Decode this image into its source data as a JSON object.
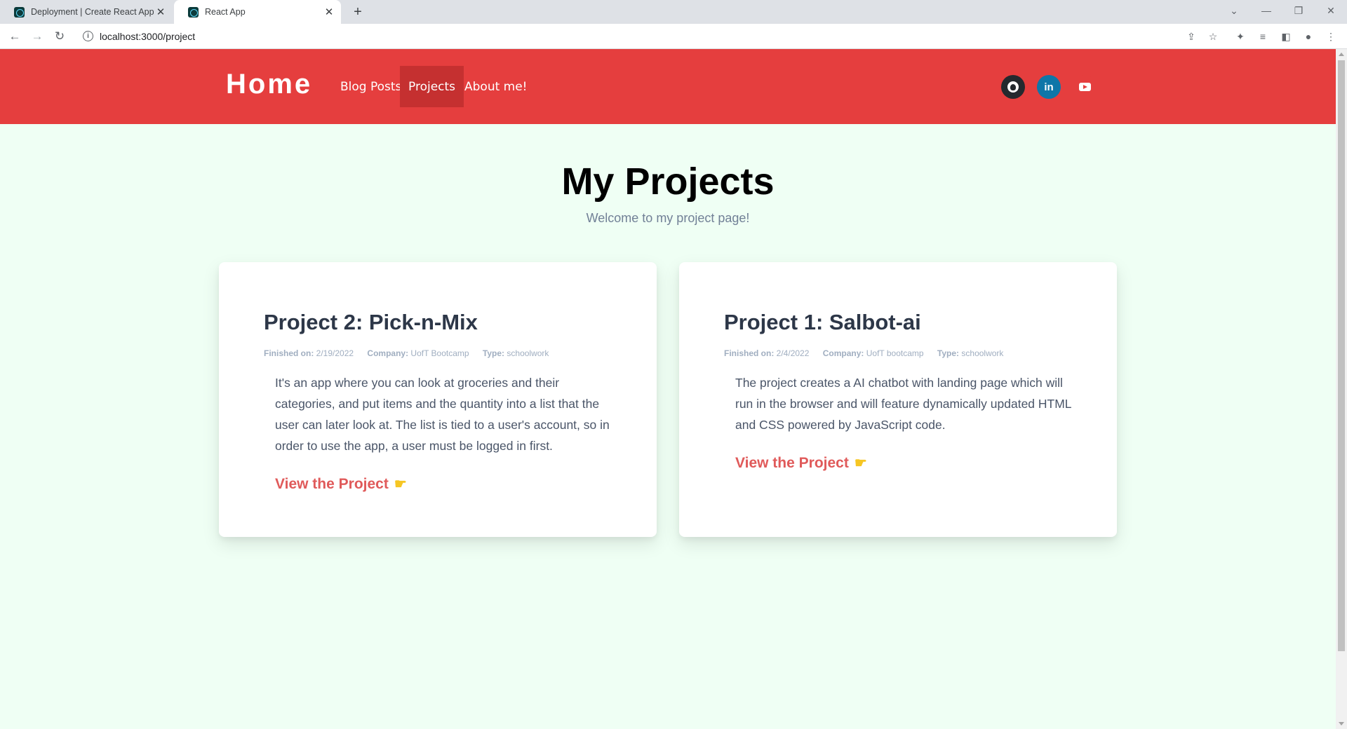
{
  "browser": {
    "tabs": [
      {
        "title": "Deployment | Create React App",
        "active": false
      },
      {
        "title": "React App",
        "active": true
      }
    ],
    "url": "localhost:3000/project"
  },
  "site": {
    "brand": "Home",
    "nav": [
      {
        "label": "Blog Posts",
        "active": false
      },
      {
        "label": "Projects",
        "active": true
      },
      {
        "label": "About me!",
        "active": false
      }
    ],
    "social": {
      "github_icon": "github-icon",
      "linkedin_glyph": "in",
      "youtube_icon": "youtube-icon"
    },
    "colors": {
      "nav_bg": "#e53e3e",
      "nav_active": "#c53030",
      "page_bg": "#effff4",
      "link": "#e05a5a"
    }
  },
  "page": {
    "title": "My Projects",
    "subtitle": "Welcome to my project page!"
  },
  "projects": [
    {
      "title": "Project 2: Pick-n-Mix",
      "finished_label": "Finished on:",
      "finished": "2/19/2022",
      "company_label": "Company:",
      "company": "UofT Bootcamp",
      "type_label": "Type:",
      "type": "schoolwork",
      "description": "It's an app where you can look at groceries and their categories, and put items and the quantity into a list that the user can later look at. The list is tied to a user's account, so in order to use the app, a user must be logged in first.",
      "link_label": "View the Project",
      "link_icon": "pointing-hand-icon"
    },
    {
      "title": "Project 1: Salbot-ai",
      "finished_label": "Finished on:",
      "finished": "2/4/2022",
      "company_label": "Company:",
      "company": "UofT bootcamp",
      "type_label": "Type:",
      "type": "schoolwork",
      "description": "The project creates a AI chatbot with landing page which will run in the browser and will feature dynamically updated HTML and CSS powered by JavaScript code.",
      "link_label": "View the Project",
      "link_icon": "pointing-hand-icon"
    }
  ]
}
